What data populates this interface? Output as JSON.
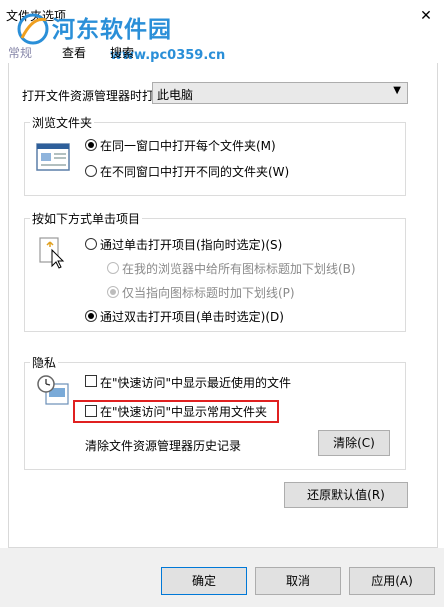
{
  "window": {
    "title": "文件夹选项",
    "close_glyph": "✕"
  },
  "watermark": {
    "title": "河东软件园",
    "url": "www.pc0359.cn"
  },
  "tabs": [
    {
      "label": "常规"
    },
    {
      "label": "查看"
    },
    {
      "label": "搜索"
    }
  ],
  "open_explorer": {
    "label": "打开文件资源管理器时打",
    "selected": "此电脑"
  },
  "browse_folders": {
    "title": "浏览文件夹",
    "options": [
      {
        "label": "在同一窗口中打开每个文件夹(M)",
        "checked": true
      },
      {
        "label": "在不同窗口中打开不同的文件夹(W)",
        "checked": false
      }
    ]
  },
  "click_items": {
    "title": "按如下方式单击项目",
    "single_click": {
      "label": "通过单击打开项目(指向时选定)(S)",
      "checked": false
    },
    "underline_all": {
      "label": "在我的浏览器中给所有图标标题加下划线(B)",
      "checked": false
    },
    "underline_point": {
      "label": "仅当指向图标标题时加下划线(P)",
      "checked": true
    },
    "double_click": {
      "label": "通过双击打开项目(单击时选定)(D)",
      "checked": true
    }
  },
  "privacy": {
    "title": "隐私",
    "recent_files": {
      "label": "在\"快速访问\"中显示最近使用的文件",
      "checked": false
    },
    "frequent_folders": {
      "label": "在\"快速访问\"中显示常用文件夹",
      "checked": false
    },
    "clear_label": "清除文件资源管理器历史记录",
    "clear_button": "清除(C)"
  },
  "restore_defaults": "还原默认值(R)",
  "footer": {
    "ok": "确定",
    "cancel": "取消",
    "apply": "应用(A)"
  },
  "colors": {
    "watermark": "#2a8fd8",
    "highlight": "#e02020",
    "primary_border": "#0078d7"
  }
}
